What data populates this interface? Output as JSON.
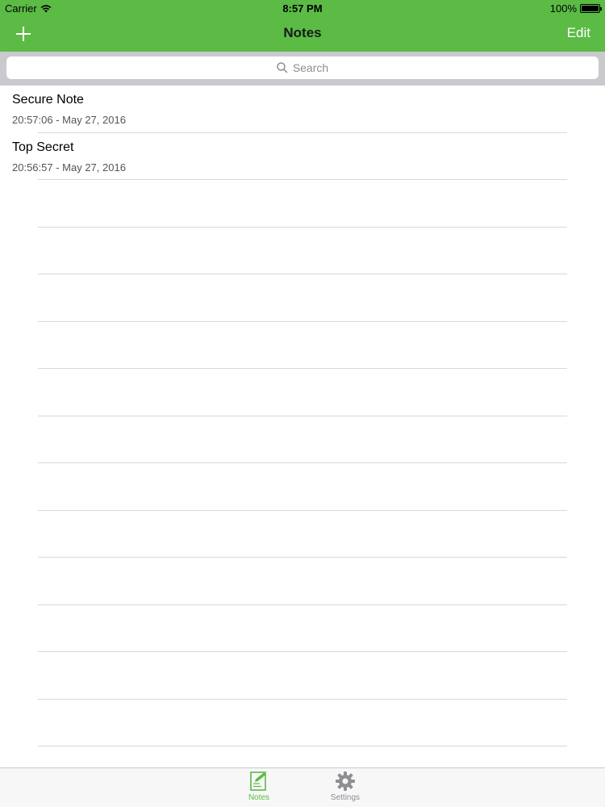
{
  "status_bar": {
    "carrier": "Carrier",
    "time": "8:57 PM",
    "battery": "100%"
  },
  "nav_bar": {
    "add_label": "+",
    "title": "Notes",
    "edit_label": "Edit"
  },
  "search": {
    "placeholder": "Search"
  },
  "notes": [
    {
      "title": "Secure Note",
      "date": "20:57:06 - May 27, 2016"
    },
    {
      "title": "Top Secret",
      "date": "20:56:57 - May 27, 2016"
    }
  ],
  "tab_bar": {
    "tabs": [
      {
        "label": "Notes",
        "icon": "note-edit-icon",
        "selected": true
      },
      {
        "label": "Settings",
        "icon": "gear-icon",
        "selected": false
      }
    ]
  },
  "colors": {
    "accent": "#5bbb45",
    "search_background": "#c9c9ce",
    "tab_inactive": "#8e8e93"
  }
}
